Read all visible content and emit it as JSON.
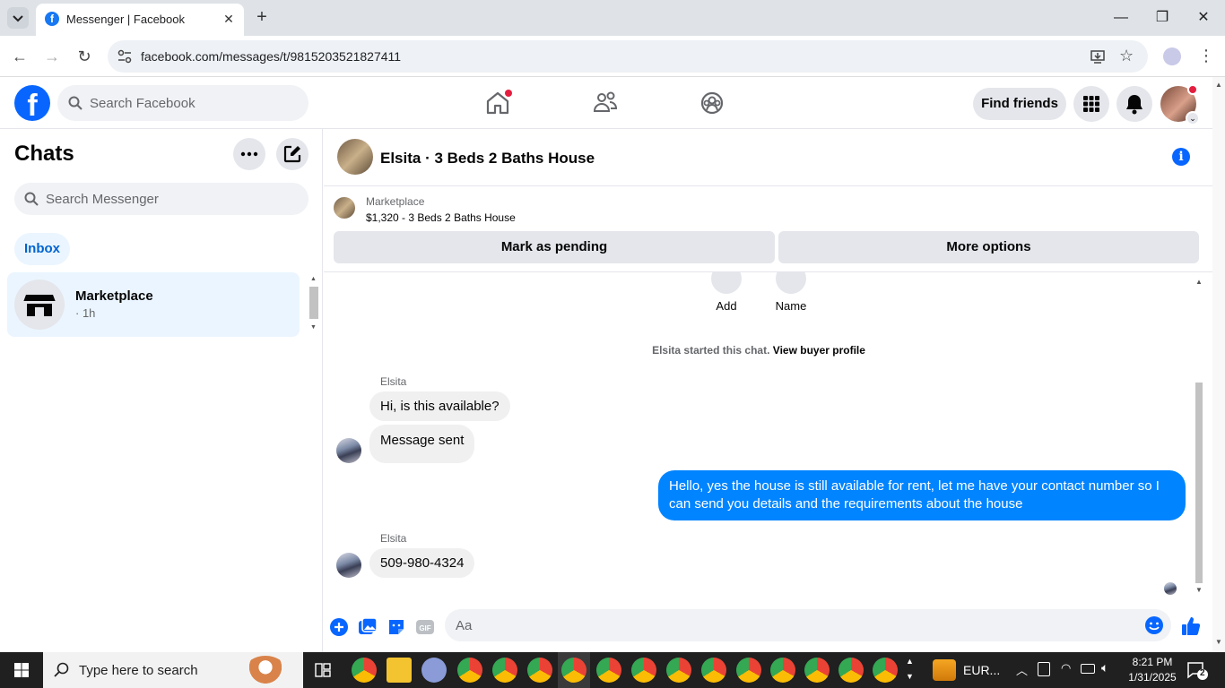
{
  "browser": {
    "tab_title": "Messenger | Facebook",
    "url": "facebook.com/messages/t/9815203521827411",
    "window_controls": [
      "minimize-icon",
      "restore-icon",
      "close-icon"
    ]
  },
  "fb_nav": {
    "logo_glyph": "f",
    "search_placeholder": "Search Facebook",
    "nav_icons": [
      "home-icon",
      "friends-icon",
      "groups-icon"
    ],
    "find_friends_label": "Find friends",
    "accent_color": "#0866ff"
  },
  "chats_panel": {
    "title": "Chats",
    "search_placeholder": "Search Messenger",
    "inbox_label": "Inbox",
    "items": [
      {
        "name": "Marketplace",
        "time": "· 1h"
      }
    ]
  },
  "conversation": {
    "title": "Elsita · 3 Beds 2 Baths House",
    "listing": {
      "label": "Marketplace",
      "price_title": "$1,320 - 3 Beds 2 Baths House",
      "mark_pending_label": "Mark as pending",
      "more_options_label": "More options"
    },
    "quick_actions": [
      {
        "label": "Add",
        "icon": "add-icon"
      },
      {
        "label": "Name",
        "icon": "pencil-icon"
      }
    ],
    "system_note": "Elsita started this chat.",
    "system_link": "View buyer profile",
    "messages": [
      {
        "sender": "Elsita",
        "text": "Hi, is this available?",
        "direction": "in"
      },
      {
        "sender": "",
        "text": "Message sent",
        "direction": "in"
      },
      {
        "sender": "",
        "text": "Hello, yes the house is still available for rent, let me have your contact number so I can send you details and the requirements about the house",
        "direction": "out"
      },
      {
        "sender": "Elsita",
        "text": "509-980-4324",
        "direction": "in"
      }
    ],
    "composer_placeholder": "Aa",
    "outgoing_color": "#0084ff"
  },
  "taskbar": {
    "search_placeholder": "Type here to search",
    "tray_label": "EUR...",
    "time": "8:21 PM",
    "date": "1/31/2025",
    "notification_count": "2"
  }
}
